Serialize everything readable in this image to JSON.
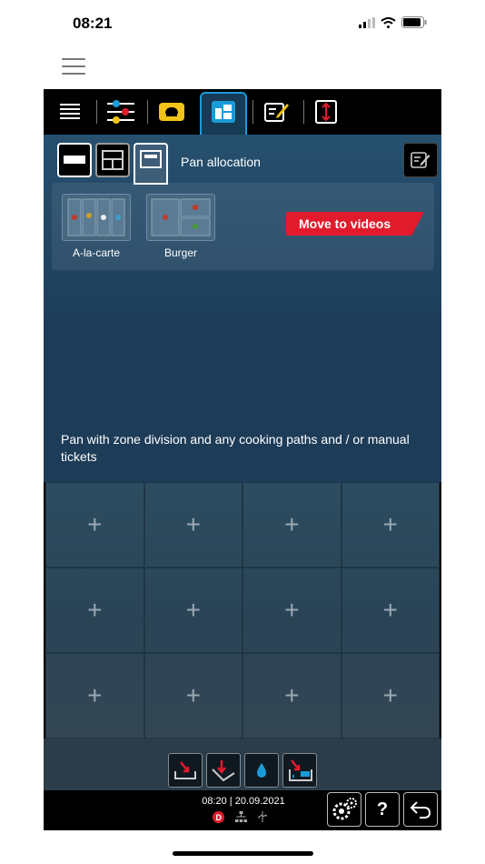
{
  "status": {
    "time": "08:21"
  },
  "header": {
    "title": "Pan allocation"
  },
  "presets": [
    {
      "label": "A-la-carte"
    },
    {
      "label": "Burger"
    }
  ],
  "videos_button": {
    "label": "Move to videos"
  },
  "description": "Pan with zone division and any cooking paths and / or manual tickets",
  "grid": {
    "cell_symbol": "+"
  },
  "footer": {
    "datetime": "08:20 | 20.09.2021",
    "help_label": "?"
  },
  "colors": {
    "accent": "#1a9bd8",
    "videos_red": "#e21b2c",
    "panel_blue": "#1d3c58"
  }
}
